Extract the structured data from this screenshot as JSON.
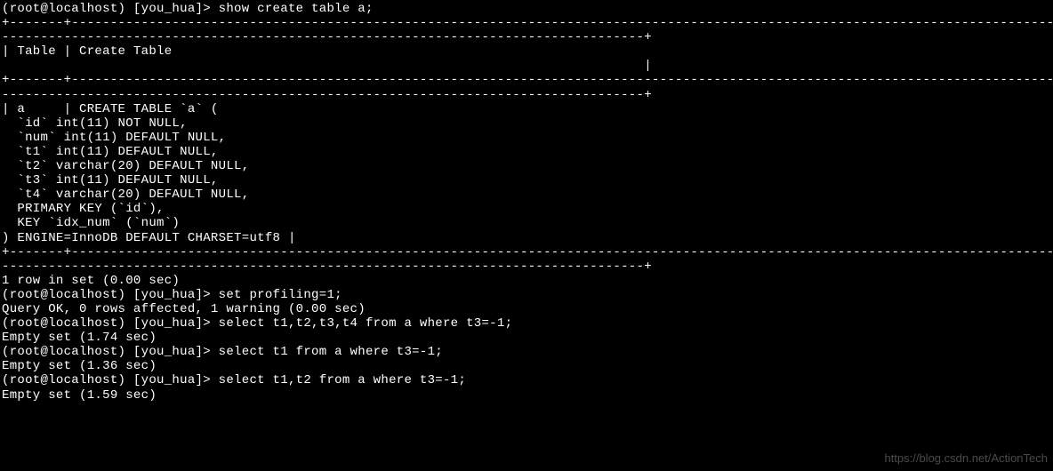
{
  "terminal": {
    "lines": [
      "(root@localhost) [you_hua]> show create table a;",
      "+-------+--------------------------------------------------------------------------------------------------------------------------------------------------------------------------",
      "-----------------------------------------------------------------------------------+",
      "| Table | Create Table",
      "                                                                                   |",
      "+-------+--------------------------------------------------------------------------------------------------------------------------------------------------------------------------",
      "-----------------------------------------------------------------------------------+",
      "| a     | CREATE TABLE `a` (",
      "  `id` int(11) NOT NULL,",
      "  `num` int(11) DEFAULT NULL,",
      "  `t1` int(11) DEFAULT NULL,",
      "  `t2` varchar(20) DEFAULT NULL,",
      "  `t3` int(11) DEFAULT NULL,",
      "  `t4` varchar(20) DEFAULT NULL,",
      "  PRIMARY KEY (`id`),",
      "  KEY `idx_num` (`num`)",
      ") ENGINE=InnoDB DEFAULT CHARSET=utf8 |",
      "+-------+--------------------------------------------------------------------------------------------------------------------------------------------------------------------------",
      "-----------------------------------------------------------------------------------+",
      "1 row in set (0.00 sec)",
      "",
      "(root@localhost) [you_hua]> set profiling=1;",
      "Query OK, 0 rows affected, 1 warning (0.00 sec)",
      "",
      "(root@localhost) [you_hua]> select t1,t2,t3,t4 from a where t3=-1;",
      "Empty set (1.74 sec)",
      "",
      "(root@localhost) [you_hua]> select t1 from a where t3=-1;",
      "Empty set (1.36 sec)",
      "",
      "(root@localhost) [you_hua]> select t1,t2 from a where t3=-1;",
      "Empty set (1.59 sec)"
    ]
  },
  "watermark": "https://blog.csdn.net/ActionTech"
}
